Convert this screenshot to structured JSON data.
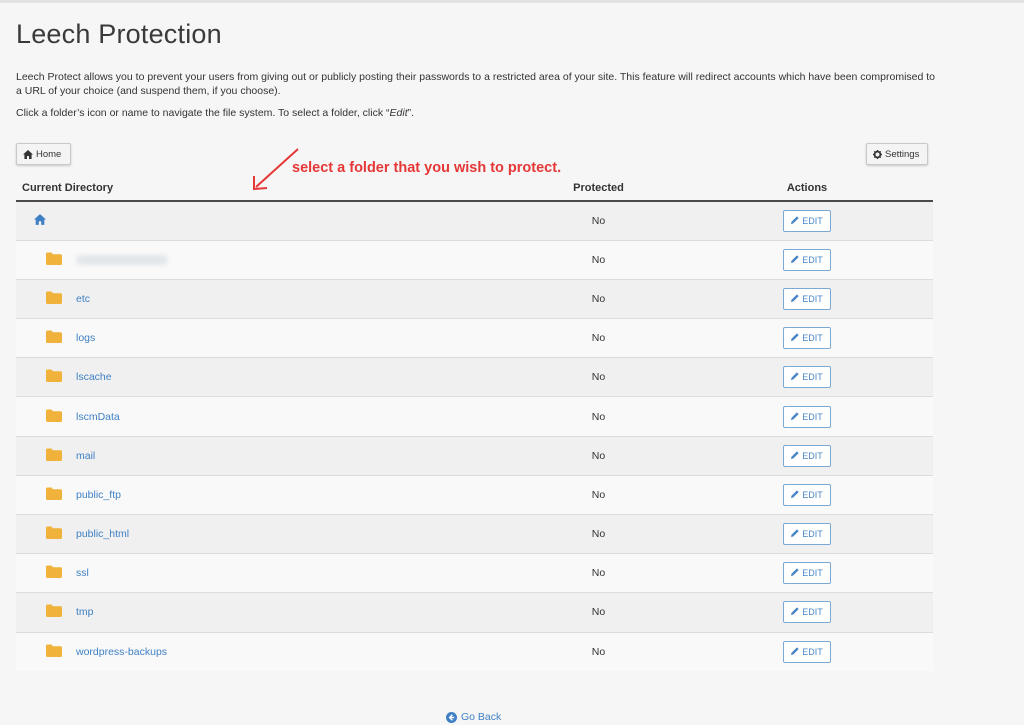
{
  "page": {
    "title": "Leech Protection",
    "description": "Leech Protect allows you to prevent your users from giving out or publicly posting their passwords to a restricted area of your site. This feature will redirect accounts which have been compromised to a URL of your choice (and suspend them, if you choose).",
    "hint_prefix": "Click a folder’s icon or name to navigate the file system. To select a folder, click “",
    "hint_edit": "Edit",
    "hint_suffix": "”."
  },
  "toolbar": {
    "home_label": "Home",
    "settings_label": "Settings"
  },
  "annotation": {
    "text": "select a folder that you wish to protect.",
    "color": "#e63737"
  },
  "table": {
    "headers": {
      "directory": "Current Directory",
      "protected": "Protected",
      "actions": "Actions"
    },
    "edit_label": "EDIT",
    "rows": [
      {
        "name": "",
        "type": "home",
        "protected": "No"
      },
      {
        "name": "",
        "type": "blurred",
        "protected": "No"
      },
      {
        "name": "etc",
        "type": "folder",
        "protected": "No"
      },
      {
        "name": "logs",
        "type": "folder",
        "protected": "No"
      },
      {
        "name": "lscache",
        "type": "folder",
        "protected": "No"
      },
      {
        "name": "lscmData",
        "type": "folder",
        "protected": "No"
      },
      {
        "name": "mail",
        "type": "folder",
        "protected": "No"
      },
      {
        "name": "public_ftp",
        "type": "folder",
        "protected": "No"
      },
      {
        "name": "public_html",
        "type": "folder",
        "protected": "No"
      },
      {
        "name": "ssl",
        "type": "folder",
        "protected": "No"
      },
      {
        "name": "tmp",
        "type": "folder",
        "protected": "No"
      },
      {
        "name": "wordpress-backups",
        "type": "folder",
        "protected": "No"
      }
    ]
  },
  "footer": {
    "go_back_label": "Go Back"
  },
  "colors": {
    "link": "#3f80c4",
    "folder": "#f0b23a",
    "accent": "#4a86c5"
  },
  "icons": {
    "home": "home-icon",
    "settings": "gear-icon",
    "folder": "folder-icon",
    "edit": "pencil-icon",
    "back": "circle-arrow-left-icon"
  }
}
